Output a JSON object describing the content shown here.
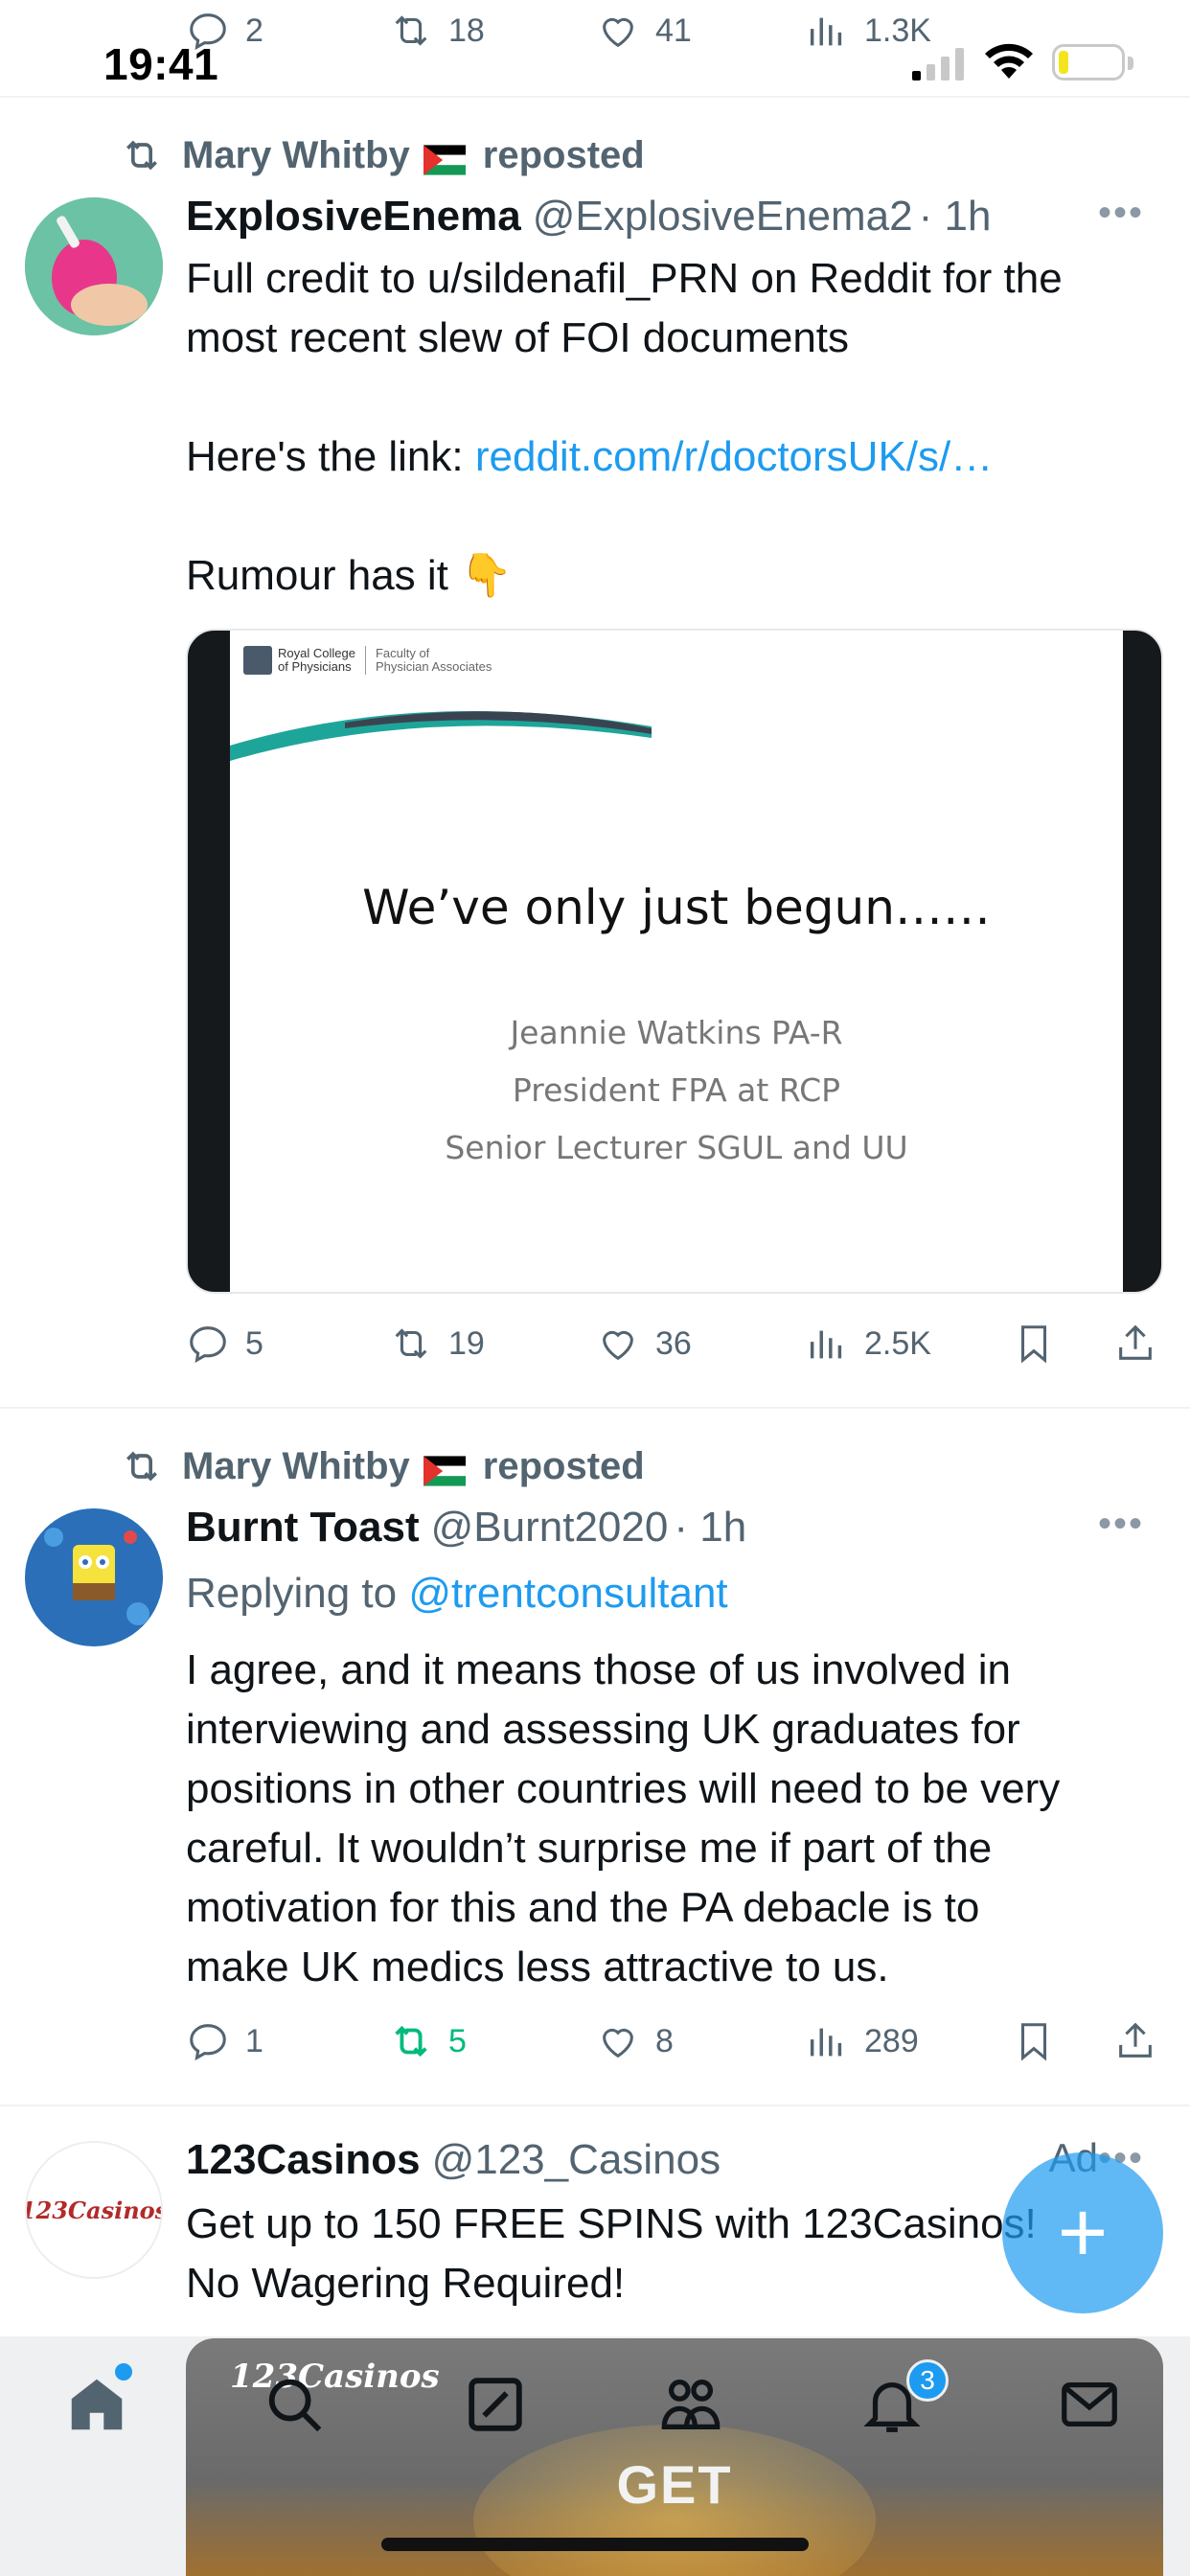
{
  "status_bar": {
    "time": "19:41"
  },
  "top_actions": {
    "replies": "2",
    "reposts": "18",
    "likes": "41",
    "views": "1.3K"
  },
  "tweets": [
    {
      "reposted_by": "Mary Whitby",
      "reposted_suffix": "reposted",
      "name": "ExplosiveEnema",
      "handle": "@ExplosiveEnema2",
      "time": "· 1h",
      "text_line1": "Full credit to u/sildenafil_PRN on Reddit for the",
      "text_line2": "most recent slew of FOI documents",
      "link_prefix": "Here's the link: ",
      "link_text": "reddit.com/r/doctorsUK/s/…",
      "text_line4": "Rumour has it 👇",
      "media": {
        "logo_line1": "Royal College",
        "logo_line2": "of Physicians",
        "faculty_line1": "Faculty of",
        "faculty_line2": "Physician Associates",
        "title": "We’ve only just begun……",
        "line1": "Jeannie Watkins PA-R",
        "line2": "President FPA at RCP",
        "line3": "Senior Lecturer SGUL and UU"
      },
      "actions": {
        "replies": "5",
        "reposts": "19",
        "likes": "36",
        "views": "2.5K"
      }
    },
    {
      "reposted_by": "Mary Whitby",
      "reposted_suffix": "reposted",
      "name": "Burnt Toast",
      "handle": "@Burnt2020",
      "time": "· 1h",
      "replying_prefix": "Replying to ",
      "replying_to": "@trentconsultant",
      "lines": [
        "I agree, and it means those of us involved in",
        "interviewing and assessing UK graduates for",
        "positions in other countries will need to be very",
        "careful. It wouldn’t surprise me if part of the",
        "motivation for this and the PA debacle is to",
        "make UK medics less attractive to us."
      ],
      "actions": {
        "replies": "1",
        "reposts": "5",
        "likes": "8",
        "views": "289"
      }
    },
    {
      "name": "123Casinos",
      "handle": "@123_Casinos",
      "ad_label": "Ad",
      "avatar_text": "123Casinos",
      "text_line1": "Get up to 150 FREE SPINS with 123Casinos!",
      "text_line2": "No Wagering Required!"
    }
  ],
  "ad_overlay": {
    "brand": "123Casinos",
    "cta": "GET"
  },
  "bottom_nav": {
    "notifications_badge": "3"
  },
  "colors": {
    "accent": "#1d9bf0",
    "repost_active": "#00ba7c",
    "muted": "#536471"
  }
}
